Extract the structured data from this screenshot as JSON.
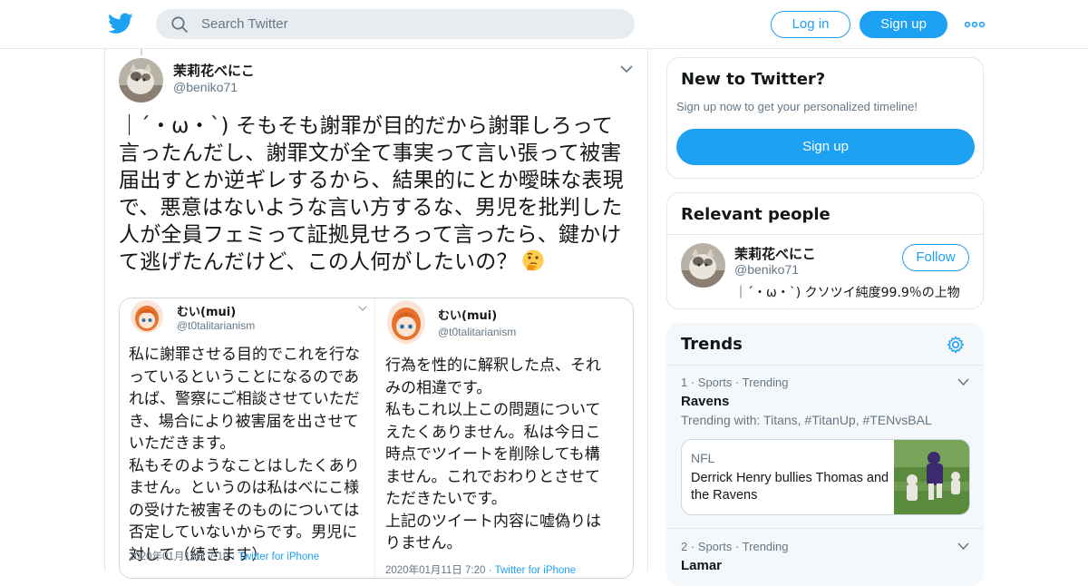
{
  "header": {
    "search_placeholder": "Search Twitter",
    "login_label": "Log in",
    "signup_label": "Sign up"
  },
  "tweet": {
    "author_name": "茉莉花べにこ",
    "author_handle": "@beniko71",
    "text_lines": [
      "｜´・ω・`) そもそも謝罪が目的だから謝罪しろって",
      "言ったんだし、謝罪文が全て事実って言い張って被害",
      "届出すとか逆ギレするから、結果的にとか曖昧な表現",
      "で、悪意はないような言い方するな、男児を批判した",
      "人が全員フェミって証拠見せろって言ったら、鍵かけ",
      "て逃げたんだけど、この人何がしたいの？"
    ],
    "emoji": "thinking-face-emoji",
    "media": {
      "left": {
        "name": "むい(mui)",
        "handle": "@t0talitarianism",
        "body": "私に謝罪させる目的でこれを行な\nっているということになるのであ\nれば、警察にご相談させていただ\nき、場合により被害届を出させて\nいただきます。\n私もそのようなことはしたくあり\nません。というのは私はべにこ様\nの受けた被害そのものについては\n否定していないからです。男児に\n対して（続きます）",
        "date": "2020年01月11日 7:19 · ",
        "source": "Twitter for iPhone"
      },
      "right": {
        "name": "むい(mui)",
        "handle": "@t0talitarianism",
        "body": "行為を性的に解釈した点、それ\nみの相違です。\n私もこれ以上この問題について\nえたくありません。私は今日こ\n時点でツイートを削除しても構\nません。これでおわりとさせて\nただきたいです。\n上記のツイート内容に嘘偽りは\nりません。",
        "date": "2020年01月11日 7:20 · ",
        "source": "Twitter for iPhone"
      }
    }
  },
  "sidebar": {
    "new_to_twitter": {
      "title": "New to Twitter?",
      "subtitle": "Sign up now to get your personalized timeline!",
      "button": "Sign up"
    },
    "relevant_people": {
      "title": "Relevant people",
      "name": "茉莉花べにこ",
      "handle": "@beniko71",
      "bio": "｜´・ω・`) クソツイ純度99.9％の上物",
      "follow_label": "Follow"
    },
    "trends": {
      "title": "Trends",
      "items": [
        {
          "meta": "1 · Sports · Trending",
          "name": "Ravens",
          "with": "Trending with: Titans, #TitanUp, #TENvsBAL",
          "news_source": "NFL",
          "news_title": "Derrick Henry bullies Thomas and the Ravens"
        },
        {
          "meta": "2 · Sports · Trending",
          "name": "Lamar"
        }
      ]
    }
  },
  "colors": {
    "brand": "#1da1f2",
    "text": "#14171a",
    "secondary": "#657786",
    "border": "#e1e8ed"
  }
}
